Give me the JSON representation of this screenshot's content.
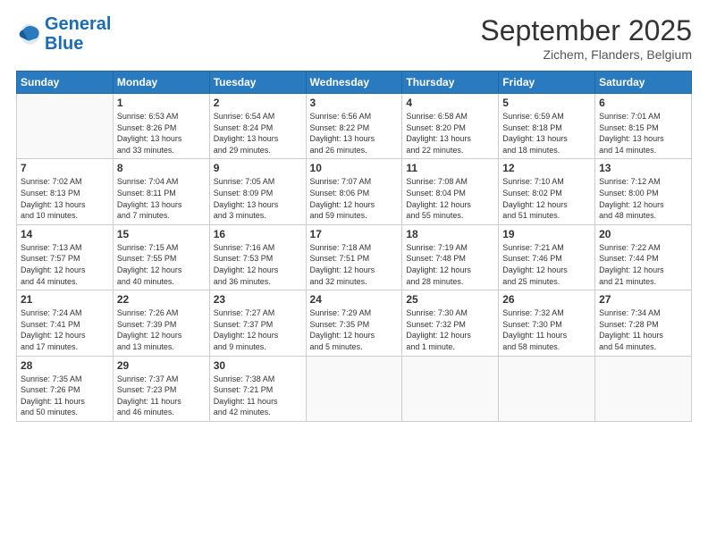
{
  "logo": {
    "line1": "General",
    "line2": "Blue"
  },
  "title": "September 2025",
  "subtitle": "Zichem, Flanders, Belgium",
  "weekdays": [
    "Sunday",
    "Monday",
    "Tuesday",
    "Wednesday",
    "Thursday",
    "Friday",
    "Saturday"
  ],
  "weeks": [
    [
      {
        "day": "",
        "info": ""
      },
      {
        "day": "1",
        "info": "Sunrise: 6:53 AM\nSunset: 8:26 PM\nDaylight: 13 hours\nand 33 minutes."
      },
      {
        "day": "2",
        "info": "Sunrise: 6:54 AM\nSunset: 8:24 PM\nDaylight: 13 hours\nand 29 minutes."
      },
      {
        "day": "3",
        "info": "Sunrise: 6:56 AM\nSunset: 8:22 PM\nDaylight: 13 hours\nand 26 minutes."
      },
      {
        "day": "4",
        "info": "Sunrise: 6:58 AM\nSunset: 8:20 PM\nDaylight: 13 hours\nand 22 minutes."
      },
      {
        "day": "5",
        "info": "Sunrise: 6:59 AM\nSunset: 8:18 PM\nDaylight: 13 hours\nand 18 minutes."
      },
      {
        "day": "6",
        "info": "Sunrise: 7:01 AM\nSunset: 8:15 PM\nDaylight: 13 hours\nand 14 minutes."
      }
    ],
    [
      {
        "day": "7",
        "info": "Sunrise: 7:02 AM\nSunset: 8:13 PM\nDaylight: 13 hours\nand 10 minutes."
      },
      {
        "day": "8",
        "info": "Sunrise: 7:04 AM\nSunset: 8:11 PM\nDaylight: 13 hours\nand 7 minutes."
      },
      {
        "day": "9",
        "info": "Sunrise: 7:05 AM\nSunset: 8:09 PM\nDaylight: 13 hours\nand 3 minutes."
      },
      {
        "day": "10",
        "info": "Sunrise: 7:07 AM\nSunset: 8:06 PM\nDaylight: 12 hours\nand 59 minutes."
      },
      {
        "day": "11",
        "info": "Sunrise: 7:08 AM\nSunset: 8:04 PM\nDaylight: 12 hours\nand 55 minutes."
      },
      {
        "day": "12",
        "info": "Sunrise: 7:10 AM\nSunset: 8:02 PM\nDaylight: 12 hours\nand 51 minutes."
      },
      {
        "day": "13",
        "info": "Sunrise: 7:12 AM\nSunset: 8:00 PM\nDaylight: 12 hours\nand 48 minutes."
      }
    ],
    [
      {
        "day": "14",
        "info": "Sunrise: 7:13 AM\nSunset: 7:57 PM\nDaylight: 12 hours\nand 44 minutes."
      },
      {
        "day": "15",
        "info": "Sunrise: 7:15 AM\nSunset: 7:55 PM\nDaylight: 12 hours\nand 40 minutes."
      },
      {
        "day": "16",
        "info": "Sunrise: 7:16 AM\nSunset: 7:53 PM\nDaylight: 12 hours\nand 36 minutes."
      },
      {
        "day": "17",
        "info": "Sunrise: 7:18 AM\nSunset: 7:51 PM\nDaylight: 12 hours\nand 32 minutes."
      },
      {
        "day": "18",
        "info": "Sunrise: 7:19 AM\nSunset: 7:48 PM\nDaylight: 12 hours\nand 28 minutes."
      },
      {
        "day": "19",
        "info": "Sunrise: 7:21 AM\nSunset: 7:46 PM\nDaylight: 12 hours\nand 25 minutes."
      },
      {
        "day": "20",
        "info": "Sunrise: 7:22 AM\nSunset: 7:44 PM\nDaylight: 12 hours\nand 21 minutes."
      }
    ],
    [
      {
        "day": "21",
        "info": "Sunrise: 7:24 AM\nSunset: 7:41 PM\nDaylight: 12 hours\nand 17 minutes."
      },
      {
        "day": "22",
        "info": "Sunrise: 7:26 AM\nSunset: 7:39 PM\nDaylight: 12 hours\nand 13 minutes."
      },
      {
        "day": "23",
        "info": "Sunrise: 7:27 AM\nSunset: 7:37 PM\nDaylight: 12 hours\nand 9 minutes."
      },
      {
        "day": "24",
        "info": "Sunrise: 7:29 AM\nSunset: 7:35 PM\nDaylight: 12 hours\nand 5 minutes."
      },
      {
        "day": "25",
        "info": "Sunrise: 7:30 AM\nSunset: 7:32 PM\nDaylight: 12 hours\nand 1 minute."
      },
      {
        "day": "26",
        "info": "Sunrise: 7:32 AM\nSunset: 7:30 PM\nDaylight: 11 hours\nand 58 minutes."
      },
      {
        "day": "27",
        "info": "Sunrise: 7:34 AM\nSunset: 7:28 PM\nDaylight: 11 hours\nand 54 minutes."
      }
    ],
    [
      {
        "day": "28",
        "info": "Sunrise: 7:35 AM\nSunset: 7:26 PM\nDaylight: 11 hours\nand 50 minutes."
      },
      {
        "day": "29",
        "info": "Sunrise: 7:37 AM\nSunset: 7:23 PM\nDaylight: 11 hours\nand 46 minutes."
      },
      {
        "day": "30",
        "info": "Sunrise: 7:38 AM\nSunset: 7:21 PM\nDaylight: 11 hours\nand 42 minutes."
      },
      {
        "day": "",
        "info": ""
      },
      {
        "day": "",
        "info": ""
      },
      {
        "day": "",
        "info": ""
      },
      {
        "day": "",
        "info": ""
      }
    ]
  ]
}
